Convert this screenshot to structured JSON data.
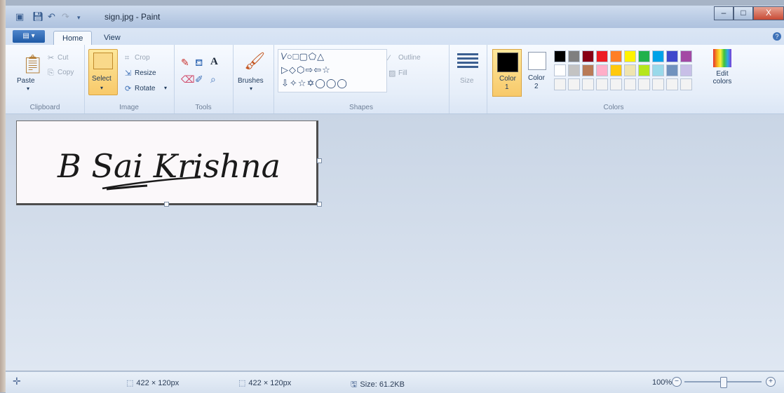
{
  "window": {
    "title": "sign.jpg - Paint",
    "buttons": {
      "minimize": "–",
      "maximize": "□",
      "close": "X"
    }
  },
  "quick_access": [
    "save-icon",
    "undo-icon",
    "redo-icon",
    "customize-icon"
  ],
  "tabs": {
    "home": "Home",
    "view": "View"
  },
  "ribbon": {
    "clipboard": {
      "paste": "Paste",
      "cut": "Cut",
      "copy": "Copy",
      "label": "Clipboard"
    },
    "image": {
      "select": "Select",
      "crop": "Crop",
      "resize": "Resize",
      "rotate": "Rotate",
      "label": "Image"
    },
    "tools": {
      "label": "Tools",
      "text_tool": "A"
    },
    "brushes": {
      "label": "Brushes"
    },
    "shapes": {
      "label": "Shapes",
      "outline": "Outline",
      "fill": "Fill",
      "row1": "\\∕○□▢⬠△",
      "row2": "▷◇⬡⇨⇦☆",
      "row3": "⇩✧☆✡◯◯◯"
    },
    "size": {
      "label": "Size"
    },
    "colors": {
      "color1": "Color",
      "color1_num": "1",
      "color2": "Color",
      "color2_num": "2",
      "edit": "Edit colors",
      "label": "Colors",
      "palette": [
        "#000000",
        "#7f7f7f",
        "#880015",
        "#ed1c24",
        "#ff7f27",
        "#fff200",
        "#22b14c",
        "#00a2e8",
        "#3f48cc",
        "#a349a4",
        "#ffffff",
        "#c3c3c3",
        "#b97a57",
        "#ffaec9",
        "#ffc90e",
        "#efe4b0",
        "#b5e61d",
        "#99d9ea",
        "#7092be",
        "#c8bfe7",
        "#f3f3f3",
        "#f3f3f3",
        "#f3f3f3",
        "#f3f3f3",
        "#f3f3f3",
        "#f3f3f3",
        "#f3f3f3",
        "#f3f3f3",
        "#f3f3f3",
        "#f3f3f3"
      ]
    }
  },
  "canvas": {
    "signature": "B Sai Krishna"
  },
  "status": {
    "cursor_size": "422 × 120px",
    "selection_size": "422 × 120px",
    "file_size": "Size: 61.2KB",
    "zoom": "100%",
    "zoom_fraction": 0.5
  }
}
